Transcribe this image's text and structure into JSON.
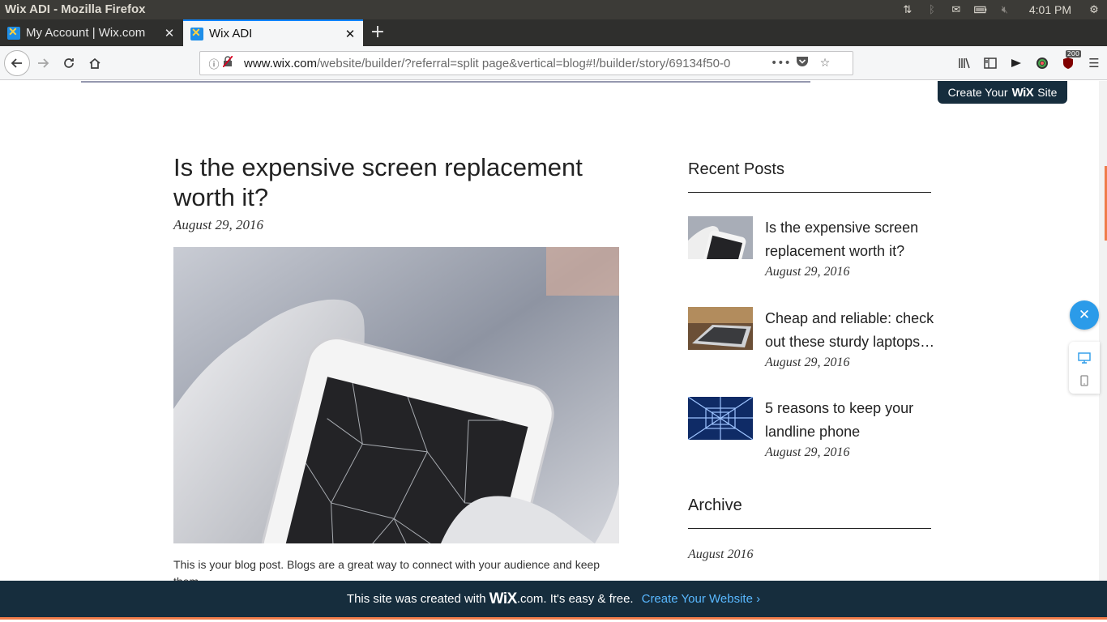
{
  "os": {
    "window_title": "Wix ADI - Mozilla Firefox",
    "clock": "4:01 PM"
  },
  "tabs": [
    {
      "label": "My Account | Wix.com",
      "active": false
    },
    {
      "label": "Wix ADI",
      "active": true
    }
  ],
  "urlbar": {
    "domain": "www.wix.com",
    "path": "/website/builder/?referral=split page&vertical=blog#!/builder/story/69134f50-0"
  },
  "toolbar": {
    "badge_count": "200"
  },
  "page": {
    "create_tag": {
      "prefix": "Create Your",
      "brand": "WiX",
      "suffix": "Site"
    },
    "post": {
      "title": "Is the expensive screen replacement worth it?",
      "date": "August 29, 2016",
      "body": "This is your blog post. Blogs are a great way to connect with your audience and keep them"
    },
    "sidebar": {
      "recent_heading": "Recent Posts",
      "recent": [
        {
          "title": "Is the expensive screen replacement worth it?",
          "date": "August 29, 2016"
        },
        {
          "title": "Cheap and reliable: check out these sturdy laptops…",
          "date": "August 29, 2016"
        },
        {
          "title": "5 reasons to keep your landline phone",
          "date": "August 29, 2016"
        }
      ],
      "archive_heading": "Archive",
      "archive_items": [
        "August 2016"
      ]
    }
  },
  "banner": {
    "text_before": "This site was created with",
    "brand": "WiX",
    "text_after": ".com. It's easy & free.",
    "cta": "Create Your Website ›"
  },
  "colors": {
    "accent": "#0a84ff",
    "wix_dark": "#162d3d",
    "cta_blue": "#59b8ff",
    "fab_blue": "#2b9be9",
    "scroll_orange": "#f07c4a"
  }
}
